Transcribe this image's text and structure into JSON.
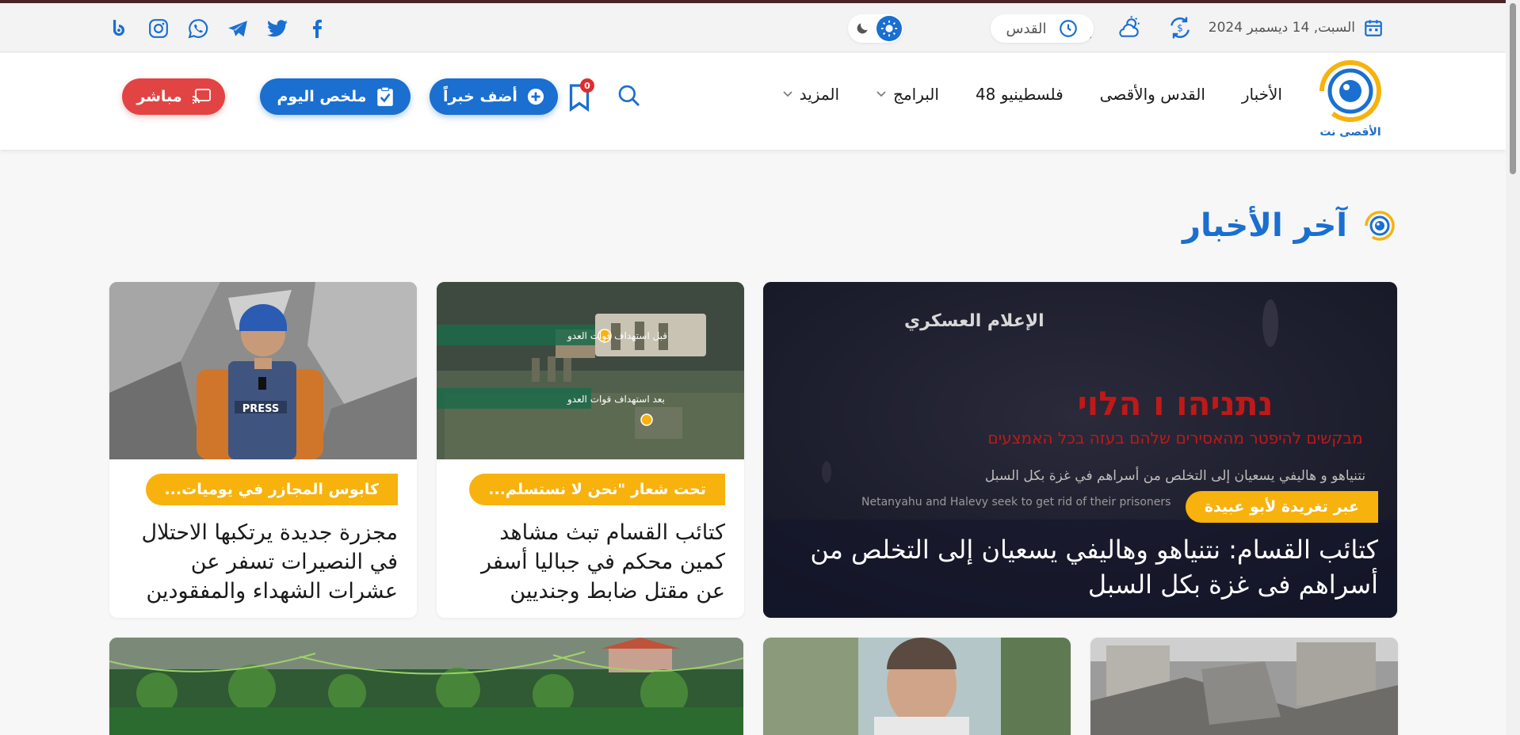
{
  "topbar": {
    "date": "السبت, 14 ديسمبر 2024",
    "city": "القدس",
    "icons": [
      "calendar-icon",
      "currency-exchange-icon",
      "weather-icon",
      "prayer-times-icon",
      "clock-icon"
    ],
    "social": [
      "facebook",
      "twitter",
      "telegram",
      "whatsapp",
      "instagram",
      "other"
    ]
  },
  "header": {
    "logo_text": "الأقصى نت",
    "nav": [
      {
        "label": "الأخبار"
      },
      {
        "label": "القدس والأقصى"
      },
      {
        "label": "فلسطينيو 48"
      },
      {
        "label": "البرامج"
      },
      {
        "label": "المزيد"
      }
    ],
    "bookmark_count": "0",
    "add_news": "أضف خبراً",
    "daily_summary": "ملخص اليوم",
    "live": "مباشر"
  },
  "section": {
    "title": "آخر الأخبار"
  },
  "cards": {
    "feature": {
      "tag": "عبر تغريدة لأبو عبيدة",
      "title": "كتائب القسام: نتنياهو وهاليفي يسعيان إلى التخلص من أسراهم فى غزة بكل السبل",
      "img_hebrew_1": "נתניהו ו הלוי",
      "img_hebrew_2": "מבקשים להיפטר מהאסירים שלהם בעזה בכל האמצעים",
      "img_arabic": "نتنياهو و هاليفي يسعيان إلى التخلص من أسراهم في غزة بكل السبل",
      "img_english": "Netanyahu and Halevy seek to get rid of their prisoners",
      "img_logo": "الإعلام العسكري"
    },
    "middle": {
      "tag": "تحت شعار \"نحن لا نستسلم...",
      "title": "كتائب القسام تبث مشاهد كمين محكم في جباليا أسفر عن مقتل ضابط وجنديين",
      "img_label_1": "قبل استهداف قوات العدو",
      "img_label_2": "بعد استهداف قوات العدو"
    },
    "left": {
      "tag": "كابوس المجازر في يوميات...",
      "title": "مجزرة جديدة يرتكبها الاحتلال في النصيرات تسفر عن عشرات الشهداء والمفقودين",
      "img_press": "PRESS"
    }
  },
  "colors": {
    "accent": "#1a6fd0",
    "tag": "#f7b20e",
    "live": "#e24444"
  }
}
